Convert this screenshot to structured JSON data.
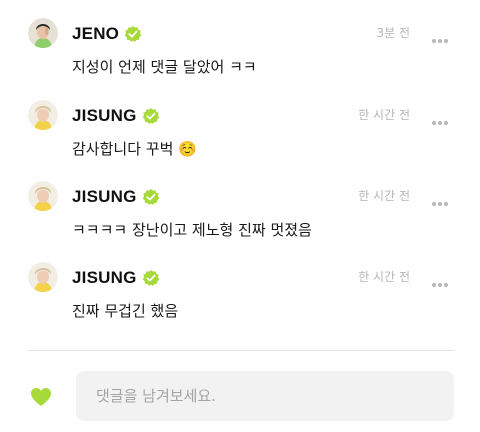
{
  "comments": [
    {
      "author": "JENO",
      "time": "3분 전",
      "text": "지성이 언제 댓글 달았어 ㅋㅋ",
      "avatar": "jeno-avatar",
      "verified": true
    },
    {
      "author": "JISUNG",
      "time": "한 시간 전",
      "text": "감사합니다 꾸벅 ☺️",
      "avatar": "jisung-avatar",
      "verified": true
    },
    {
      "author": "JISUNG",
      "time": "한 시간 전",
      "text": "ㅋㅋㅋㅋ 장난이고 제노형 진짜 멋졌음",
      "avatar": "jisung-avatar",
      "verified": true
    },
    {
      "author": "JISUNG",
      "time": "한 시간 전",
      "text": "진짜 무겁긴 했음",
      "avatar": "jisung-avatar",
      "verified": true
    }
  ],
  "footer": {
    "comment_placeholder": "댓글을 남겨보세요.",
    "like_icon": "heart-icon"
  },
  "colors": {
    "accent": "#a6d93a",
    "text": "#1a1a1a",
    "muted": "#b5b5b5",
    "input_bg": "#f2f2f2"
  }
}
